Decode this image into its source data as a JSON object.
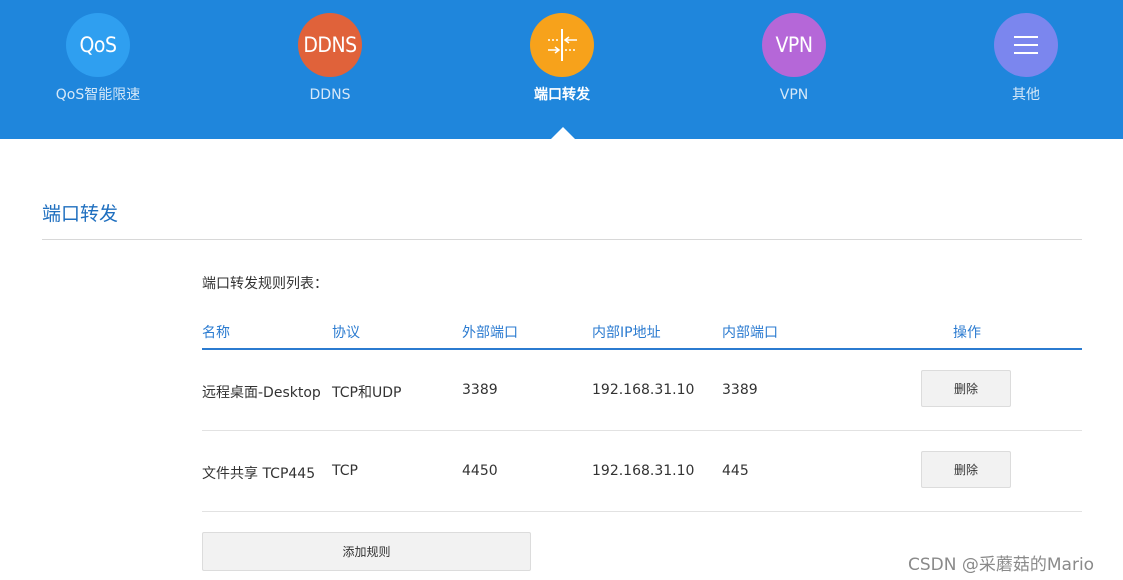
{
  "nav": {
    "items": [
      {
        "icon_text": "QoS",
        "label": "QoS智能限速",
        "color": "#2f9ff0",
        "icon": "qos-icon"
      },
      {
        "icon_text": "DDNS",
        "label": "DDNS",
        "color": "#e0623a",
        "icon": "ddns-icon"
      },
      {
        "icon_text": "",
        "label": "端口转发",
        "color": "#f7a21b",
        "icon": "port-forward-icon",
        "active": true
      },
      {
        "icon_text": "VPN",
        "label": "VPN",
        "color": "#b567d8",
        "icon": "vpn-icon"
      },
      {
        "icon_text": "",
        "label": "其他",
        "color": "#7b86ee",
        "icon": "menu-icon"
      }
    ]
  },
  "section": {
    "title": "端口转发",
    "list_caption": "端口转发规则列表："
  },
  "table": {
    "columns": [
      "名称",
      "协议",
      "外部端口",
      "内部IP地址",
      "内部端口",
      "操作"
    ],
    "rows": [
      {
        "name": "远程桌面-Desktop",
        "protocol": "TCP和UDP",
        "ext_port": "3389",
        "int_ip": "192.168.31.10",
        "int_port": "3389",
        "action": "删除"
      },
      {
        "name": "文件共享 TCP445",
        "protocol": "TCP",
        "ext_port": "4450",
        "int_ip": "192.168.31.10",
        "int_port": "445",
        "action": "删除"
      }
    ]
  },
  "add_button": "添加规则",
  "watermark": "CSDN @采蘑菇的Mario",
  "colors": {
    "topbar": "#1f86dc",
    "accent": "#2b7bd0"
  }
}
